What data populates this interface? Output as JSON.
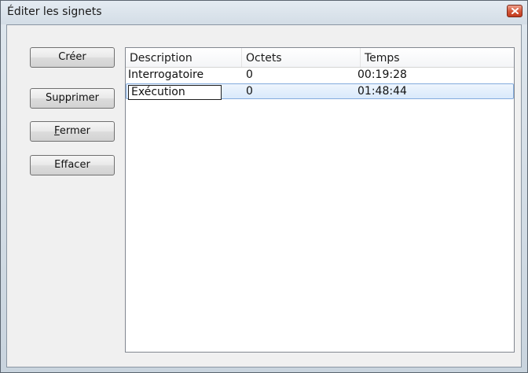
{
  "window": {
    "title": "Éditer les signets"
  },
  "buttons": {
    "create": "Créer",
    "delete": "Supprimer",
    "close_pre": "",
    "close_mnemonic": "F",
    "close_post": "ermer",
    "clear": "Effacer"
  },
  "list": {
    "columns": [
      "Description",
      "Octets",
      "Temps"
    ],
    "rows": [
      {
        "description": "Interrogatoire",
        "octets": "0",
        "temps": "00:19:28"
      },
      {
        "description": "Exécution",
        "octets": "0",
        "temps": "01:48:44"
      }
    ],
    "selected_row": 1
  },
  "colors": {
    "selection": "#d9e9fb",
    "selection_border": "#84acdd",
    "close_button": "#c23a1d"
  },
  "icons": {
    "close": "close-x-icon"
  }
}
